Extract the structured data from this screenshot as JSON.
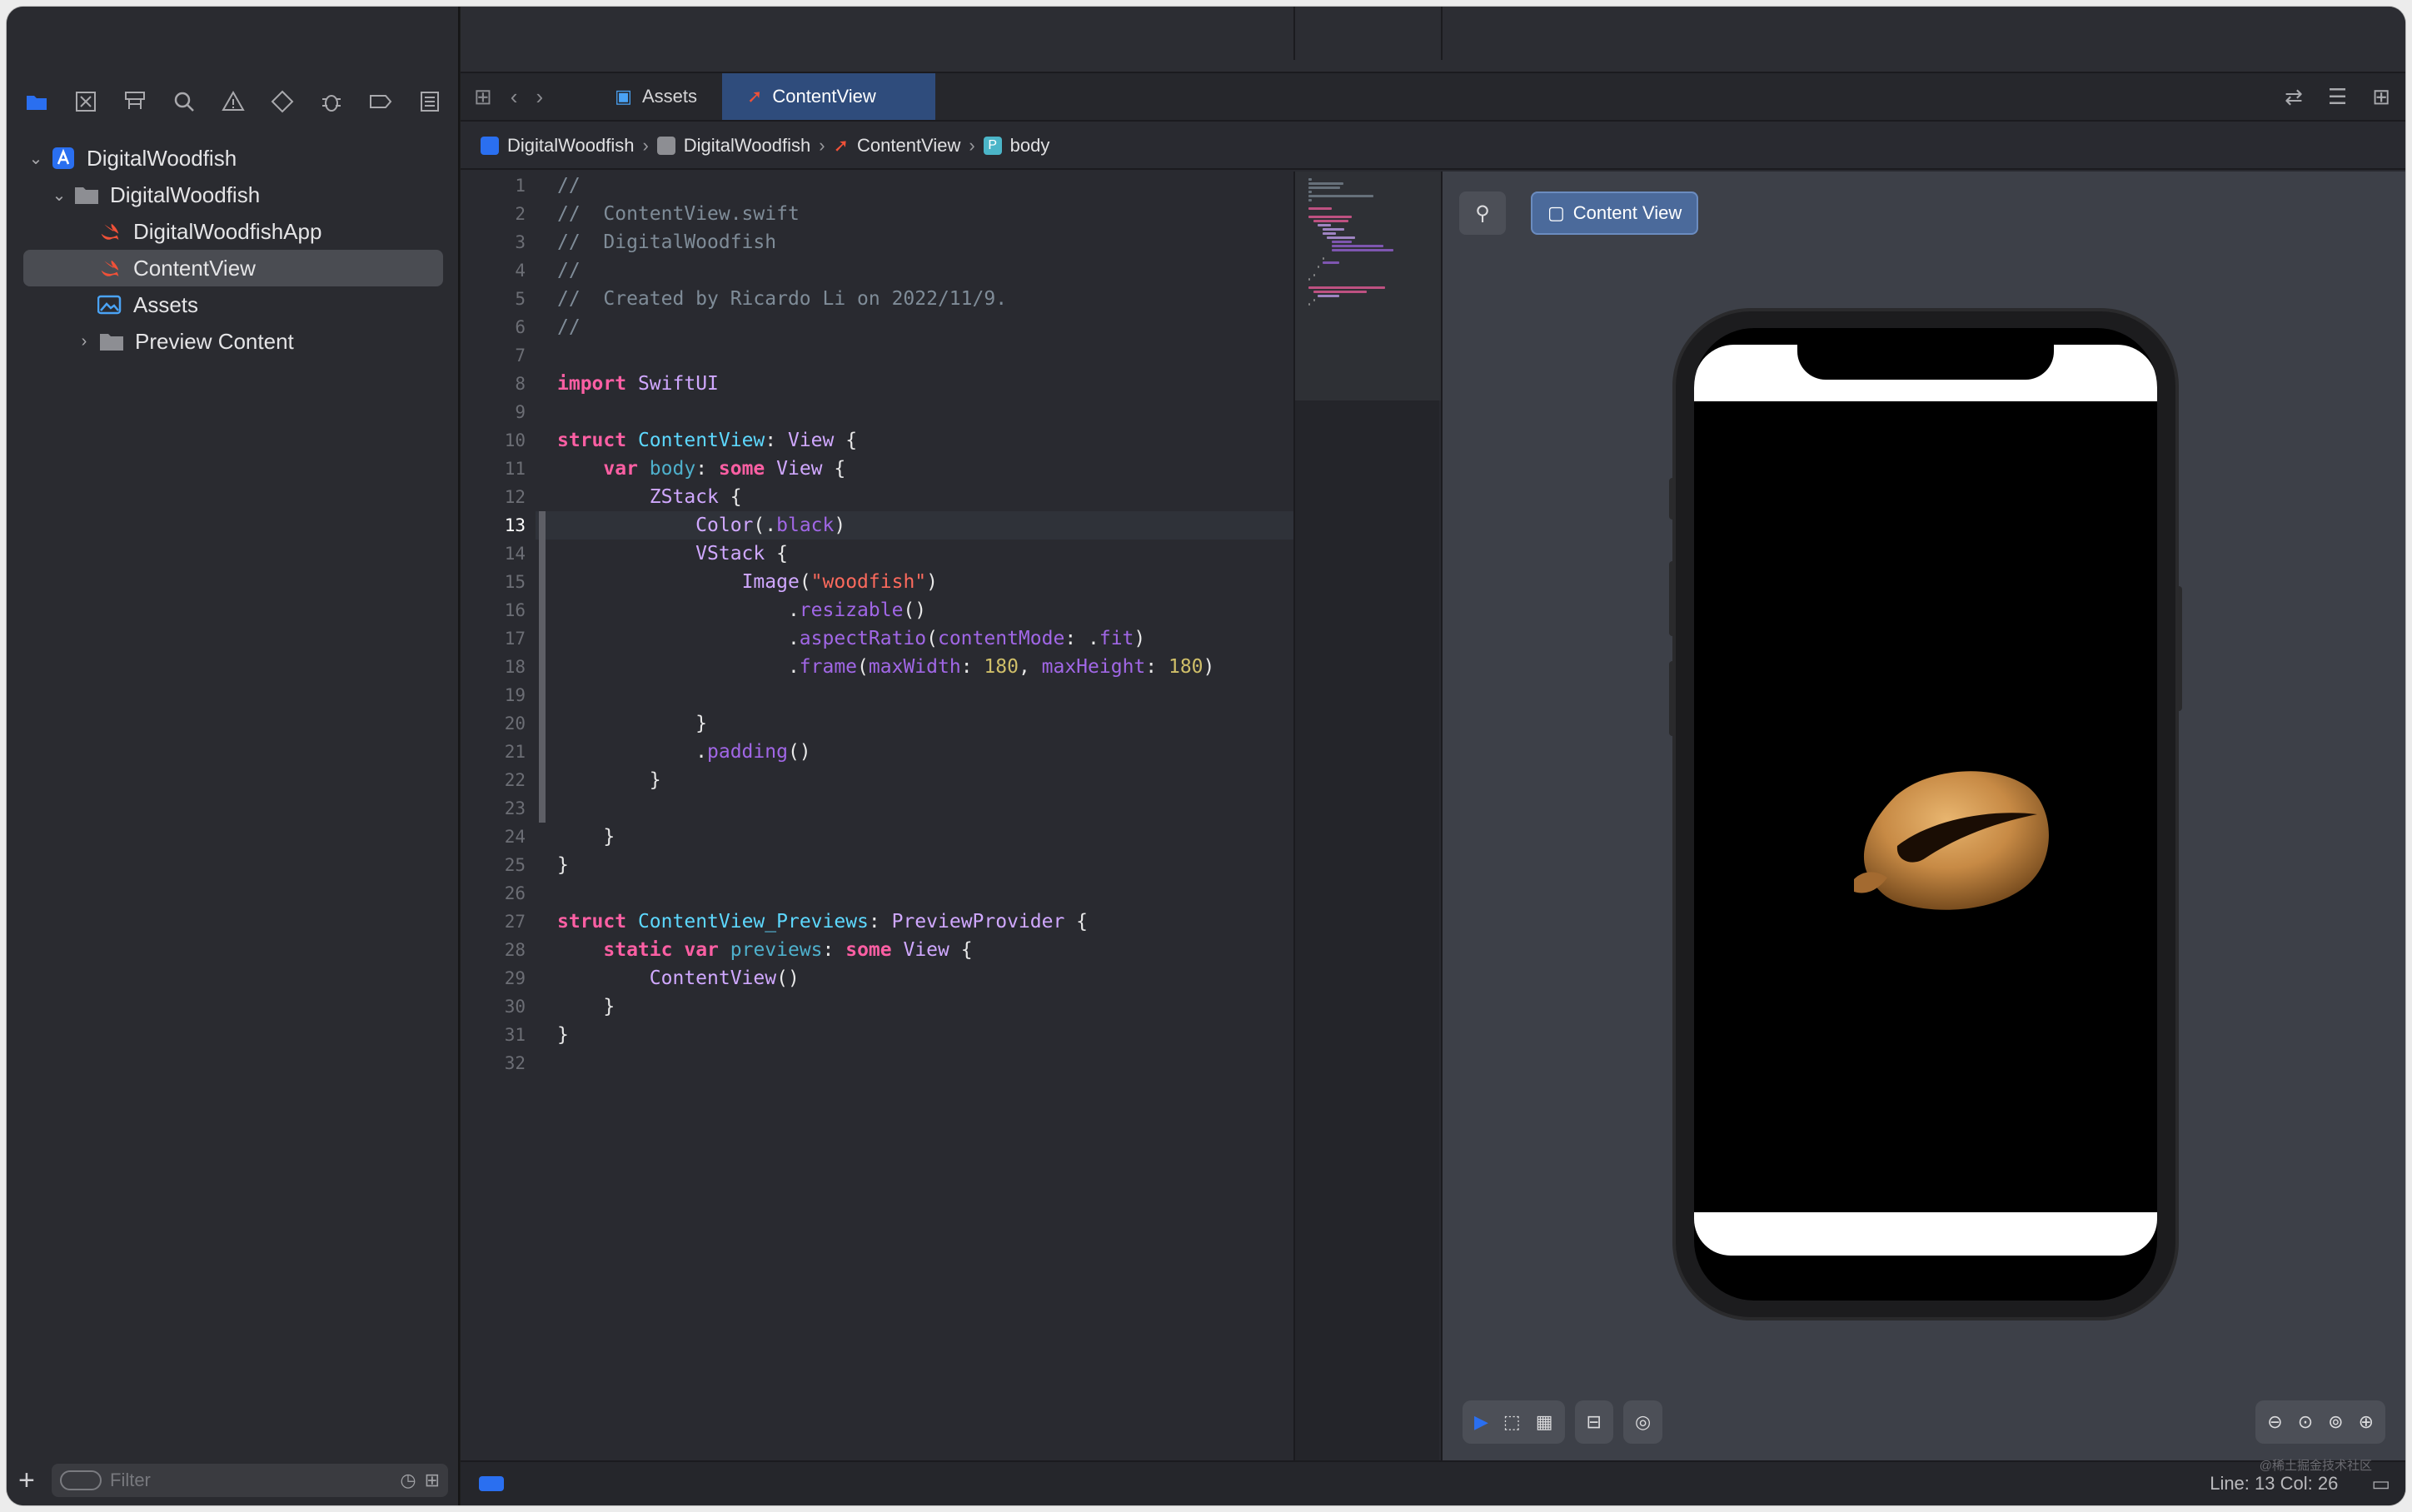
{
  "project": {
    "name": "DigitalWoodfish",
    "group": "DigitalWoodfish",
    "files": [
      "DigitalWoodfishApp",
      "ContentView",
      "Assets",
      "Preview Content"
    ],
    "selected": "ContentView"
  },
  "navigator_icons": [
    "folder-icon",
    "source-control-icon",
    "symbols-icon",
    "search-icon",
    "warning-icon",
    "test-icon",
    "debug-icon",
    "breakpoint-icon",
    "report-icon"
  ],
  "filter": {
    "placeholder": "Filter"
  },
  "tabs": [
    {
      "label": "Assets",
      "active": false
    },
    {
      "label": "ContentView",
      "active": true
    }
  ],
  "breadcrumb": [
    "DigitalWoodfish",
    "DigitalWoodfish",
    "ContentView",
    "body"
  ],
  "code_lines": [
    "//",
    "//  ContentView.swift",
    "//  DigitalWoodfish",
    "//",
    "//  Created by Ricardo Li on 2022/11/9.",
    "//",
    "",
    "import SwiftUI",
    "",
    "struct ContentView: View {",
    "    var body: some View {",
    "        ZStack {",
    "            Color(.black)",
    "            VStack {",
    "                Image(\"woodfish\")",
    "                    .resizable()",
    "                    .aspectRatio(contentMode: .fit)",
    "                    .frame(maxWidth: 180, maxHeight: 180)",
    "",
    "            }",
    "            .padding()",
    "        }",
    "",
    "    }",
    "}",
    "",
    "struct ContentView_Previews: PreviewProvider {",
    "    static var previews: some View {",
    "        ContentView()",
    "    }",
    "}",
    ""
  ],
  "current_line": 13,
  "preview": {
    "button_label": "Content View"
  },
  "status": {
    "line_col": "Line: 13  Col: 26",
    "watermark": "@稀土掘金技术社区"
  },
  "colors": {
    "keyword": "#fc5fa3",
    "type": "#5dd8ff",
    "comment": "#7f8c98",
    "string": "#fc6a5d",
    "number": "#d0bf69",
    "method": "#a167e6",
    "accent": "#2a6ff0"
  }
}
